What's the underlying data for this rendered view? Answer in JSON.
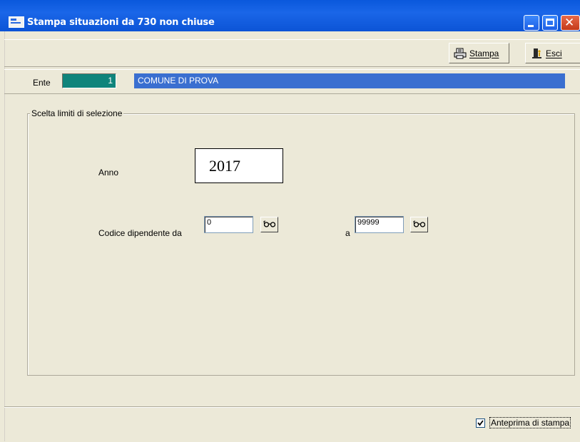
{
  "window": {
    "title": "Stampa situazioni da 730 non chiuse"
  },
  "toolbar": {
    "stampa_label": "Stampa",
    "esci_label": "Esci"
  },
  "ente": {
    "label": "Ente",
    "code": "1",
    "name": "COMUNE DI PROVA"
  },
  "selection": {
    "group_title": "Scelta limiti di selezione",
    "anno_label": "Anno",
    "anno_value": "2017",
    "codice_label": "Codice dipendente da",
    "codice_da_value": "0",
    "a_label": "a",
    "codice_a_value": "99999"
  },
  "footer": {
    "anteprima_label": "Anteprima di stampa",
    "anteprima_checked": true
  },
  "colors": {
    "titlebar": "#0a58dc",
    "ente_code_bg": "#0f847b",
    "ente_name_bg": "#3a6fd0",
    "window_bg": "#ece9d8"
  }
}
